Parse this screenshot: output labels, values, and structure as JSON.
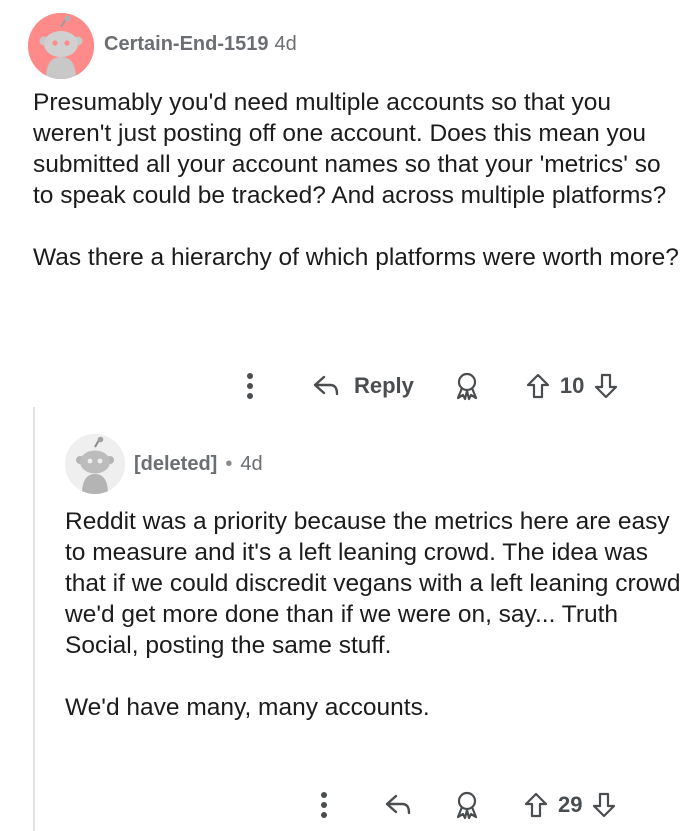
{
  "comment": {
    "username": "Certain-End-1519",
    "age": "4d",
    "paragraphs": [
      "Presumably you'd need multiple accounts so that you weren't just posting off one account. Does this mean you submitted all your account names so that your 'metrics' so to speak could be tracked? And across multiple platforms?",
      "Was there a hierarchy of which platforms were worth more?"
    ],
    "reply_label": "Reply",
    "score": "10",
    "avatar_color": "#ff8a8a"
  },
  "reply": {
    "username": "[deleted]",
    "separator": "•",
    "age": "4d",
    "paragraphs": [
      "Reddit was a priority because the metrics here are easy to measure and it's a left leaning crowd. The idea was that if we could discredit vegans with a left leaning crowd we'd get more done than if we were on, say... Truth Social, posting the same stuff.",
      "We'd have many, many accounts."
    ],
    "score": "29",
    "avatar_color": "#efefef"
  },
  "icons": {
    "more": "more-vertical-icon",
    "reply": "reply-arrow-icon",
    "award": "award-icon",
    "upvote": "upvote-icon",
    "downvote": "downvote-icon"
  }
}
